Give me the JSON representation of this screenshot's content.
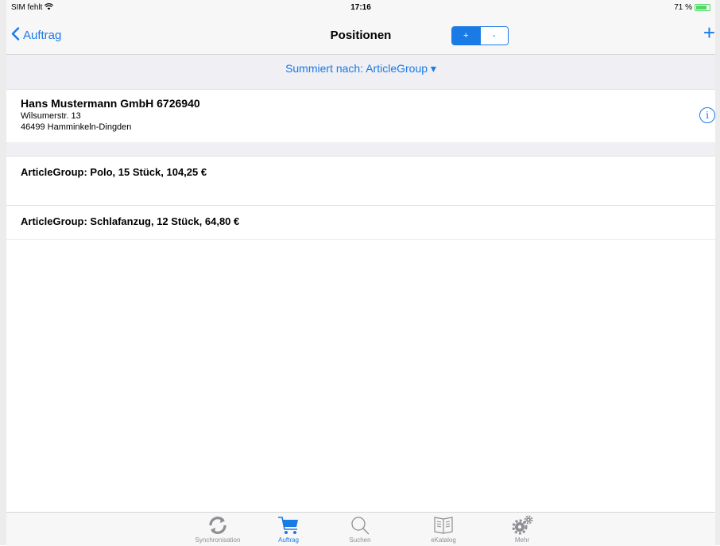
{
  "status": {
    "carrier": "SIM fehlt",
    "time": "17:16",
    "battery": "71 %"
  },
  "nav": {
    "back_label": "Auftrag",
    "title": "Positionen",
    "seg_plus": "+",
    "seg_minus": "-",
    "add": "+"
  },
  "summary": {
    "label": "Summiert nach: ArticleGroup ▾"
  },
  "customer": {
    "name": "Hans Mustermann GmbH 6726940",
    "street": "Wilsumerstr. 13",
    "city": "46499 Hamminkeln-Dingden",
    "info": "i"
  },
  "groups": [
    {
      "label": "ArticleGroup: Polo, 15 Stück, 104,25 €"
    },
    {
      "label": "ArticleGroup: Schlafanzug, 12 Stück, 64,80 €"
    }
  ],
  "tabs": [
    {
      "label": "Synchronisation",
      "icon": "sync-icon"
    },
    {
      "label": "Auftrag",
      "icon": "cart-icon"
    },
    {
      "label": "Suchen",
      "icon": "search-icon"
    },
    {
      "label": "eKatalog",
      "icon": "book-icon"
    },
    {
      "label": "Mehr",
      "icon": "gear-icon"
    }
  ],
  "colors": {
    "accent": "#1a7ae6",
    "inactive": "#8e8e93"
  }
}
